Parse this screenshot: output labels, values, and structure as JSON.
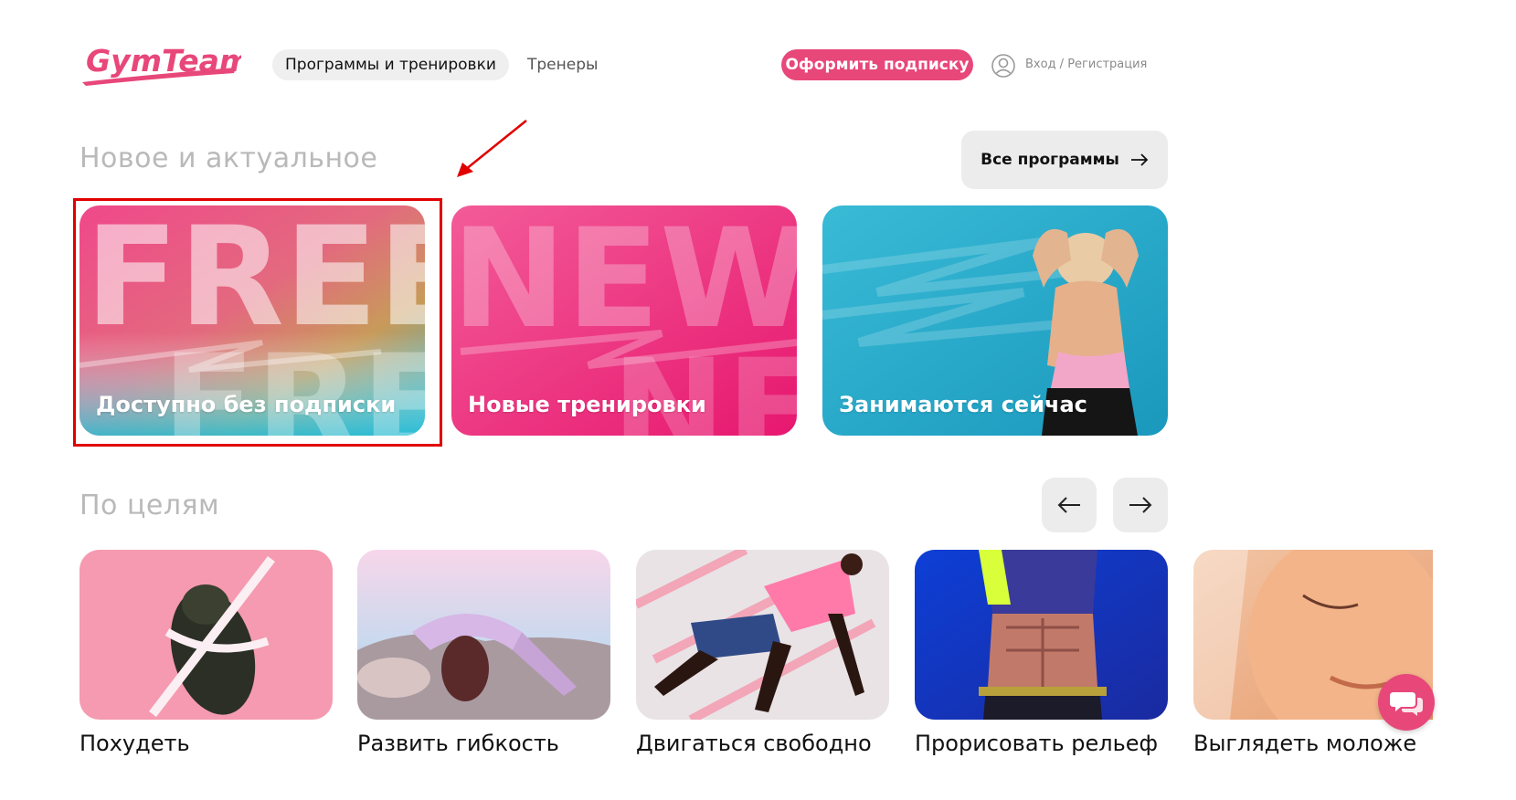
{
  "header": {
    "logo_text": "GymTeam",
    "nav_active": "Программы и тренировки",
    "nav_trainers": "Тренеры",
    "subscribe": "Оформить подписку",
    "login": "Вход / Регистрация"
  },
  "new_section": {
    "title": "Новое и актуальное",
    "all_programs": "Все программы",
    "cards": [
      {
        "label": "Доступно без подписки",
        "bg_word": "FREE"
      },
      {
        "label": "Новые тренировки",
        "bg_word": "NEW"
      },
      {
        "label": "Занимаются сейчас"
      }
    ]
  },
  "goals_section": {
    "title": "По целям",
    "items": [
      {
        "label": "Похудеть"
      },
      {
        "label": "Развить гибкость"
      },
      {
        "label": "Двигаться свободно"
      },
      {
        "label": "Прорисовать рельеф"
      },
      {
        "label": "Выглядеть моложе"
      }
    ]
  },
  "colors": {
    "accent": "#e8477a",
    "pink_card": "#ee3f86",
    "teal_card": "#2ab3cf",
    "annotation_red": "#e00000"
  }
}
